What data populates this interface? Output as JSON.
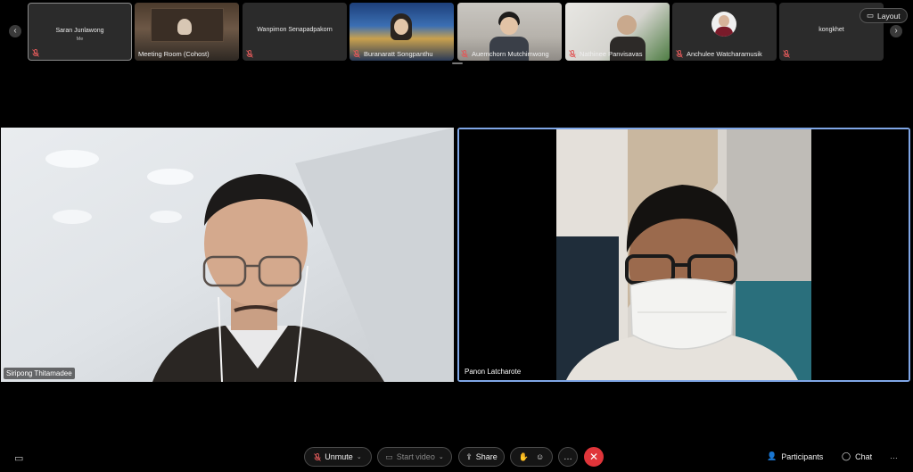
{
  "filmstrip": {
    "tiles": [
      {
        "name": "Saran Junlawong",
        "sub": "Me"
      },
      {
        "name": "Meeting Room (Cohost)"
      },
      {
        "name": "Wanpimon Senapadpakorn"
      },
      {
        "name": "Buranaratt Songpanthu"
      },
      {
        "name": "Auemchorn Mutchimwong"
      },
      {
        "name": "Nathinee Panvisavas"
      },
      {
        "name": "Anchulee Watcharamusik"
      },
      {
        "name": "kongkhet"
      }
    ],
    "layout_label": "Layout"
  },
  "stage": {
    "left_name": "Siripong Thitamadee",
    "right_name": "Panon Latcharote"
  },
  "toolbar": {
    "unmute_label": "Unmute",
    "start_video_label": "Start video",
    "share_label": "Share",
    "participants_label": "Participants",
    "chat_label": "Chat",
    "more_label": "…"
  },
  "colors": {
    "active_speaker_border": "#7fa6e6",
    "end_call": "#e0353a",
    "muted_icon": "#e05a5a"
  }
}
